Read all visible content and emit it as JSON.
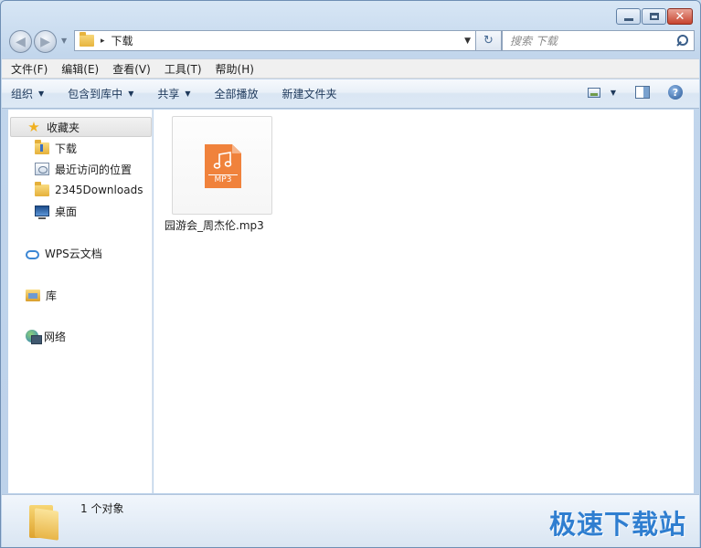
{
  "window": {
    "caption": {
      "minimize_icon": "minimize-icon",
      "maximize_icon": "maximize-icon",
      "close_icon": "close-icon",
      "close_glyph": "✕"
    }
  },
  "address_bar": {
    "back_glyph": "◀",
    "forward_glyph": "▶",
    "arrow": "▸",
    "path": "下载",
    "dropdown_glyph": "▼",
    "refresh_glyph": "↻"
  },
  "search": {
    "placeholder": "搜索 下载"
  },
  "menu": {
    "items": [
      "文件(F)",
      "编辑(E)",
      "查看(V)",
      "工具(T)",
      "帮助(H)"
    ]
  },
  "toolbar": {
    "organize": "组织",
    "include_in_library": "包含到库中",
    "share": "共享",
    "play_all": "全部播放",
    "new_folder": "新建文件夹",
    "dropdown_glyph": "▼",
    "help_glyph": "?"
  },
  "navpane": {
    "favorites": "收藏夹",
    "downloads": "下载",
    "recent": "最近访问的位置",
    "folder_2345": "2345Downloads",
    "desktop": "桌面",
    "wps_cloud": "WPS云文档",
    "library": "库",
    "network": "网络"
  },
  "files": [
    {
      "name": "园游会_周杰伦.mp3",
      "type_label": "MP3",
      "icon": "mp3-file-icon"
    }
  ],
  "status": {
    "count_text": "1 个对象"
  },
  "watermark": {
    "text": "极速下载站"
  },
  "colors": {
    "accent": "#2f7ed0",
    "mp3_orange": "#f0823c",
    "close_red": "#c7442f"
  }
}
